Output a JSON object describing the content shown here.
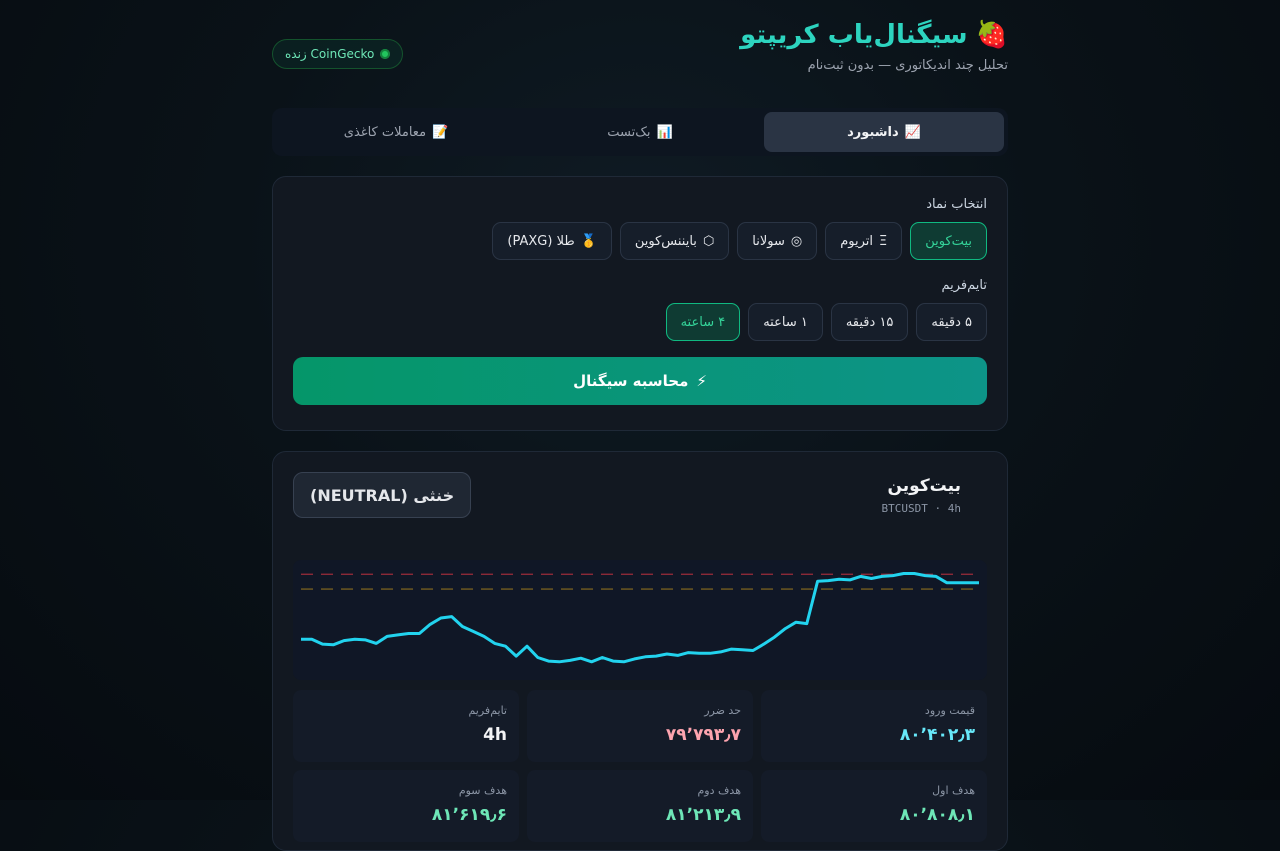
{
  "header": {
    "title": "سیگنال‌یاب کریپتو",
    "subtitle": "تحلیل چند اندیکاتوری — بدون ثبت‌نام",
    "live_label": "CoinGecko زنده"
  },
  "tabs": [
    {
      "icon": "📈",
      "label": "داشبورد",
      "active": true
    },
    {
      "icon": "📊",
      "label": "بک‌تست",
      "active": false
    },
    {
      "icon": "📝",
      "label": "معاملات کاغذی",
      "active": false
    }
  ],
  "symbol_section": {
    "label": "انتخاب نماد",
    "options": [
      {
        "icon": "",
        "label": "بیت‌کوین",
        "active": true
      },
      {
        "icon": "Ξ",
        "label": "اتریوم",
        "active": false
      },
      {
        "icon": "◎",
        "label": "سولانا",
        "active": false
      },
      {
        "icon": "⬡",
        "label": "بایننس‌کوین",
        "active": false
      },
      {
        "icon": "🥇",
        "label": "طلا (PAXG)",
        "active": false
      }
    ]
  },
  "timeframe_section": {
    "label": "تایم‌فریم",
    "options": [
      {
        "label": "۵ دقیقه",
        "active": false
      },
      {
        "label": "۱۵ دقیقه",
        "active": false
      },
      {
        "label": "۱ ساعته",
        "active": false
      },
      {
        "label": "۴ ساعته",
        "active": true
      }
    ]
  },
  "compute_button": {
    "icon": "⚡",
    "label": "محاسبه سیگنال"
  },
  "signal": {
    "coin_name": "بیت‌کوین",
    "pair": "BTCUSDT",
    "timeframe": "4h",
    "verdict": "خنثی (NEUTRAL)"
  },
  "colors": {
    "accent": "#2dd4bf",
    "line": "#22d3ee",
    "stop_line": "#9b2c3a",
    "entry_line": "#8a6d1f"
  },
  "price_series": [
    79580,
    79580,
    79510,
    79500,
    79560,
    79580,
    79570,
    79520,
    79620,
    79640,
    79660,
    79660,
    79790,
    79880,
    79900,
    79760,
    79690,
    79620,
    79520,
    79480,
    79340,
    79480,
    79320,
    79270,
    79260,
    79280,
    79310,
    79260,
    79320,
    79270,
    79260,
    79300,
    79330,
    79340,
    79370,
    79350,
    79390,
    79380,
    79380,
    79400,
    79440,
    79430,
    79420,
    79510,
    79610,
    79730,
    79820,
    79800,
    80400,
    80410,
    80430,
    80420,
    80470,
    80440,
    80470,
    80480,
    80510,
    80510,
    80480,
    80470,
    80380,
    80380,
    80380,
    80380
  ],
  "levels": {
    "stop": 80500,
    "entry": 80290
  },
  "stats": [
    {
      "label": "قیمت ورود",
      "value": "۸۰٬۴۰۲٫۳",
      "tone": "cyan"
    },
    {
      "label": "حد ضرر",
      "value": "۷۹٬۷۹۳٫۷",
      "tone": "red"
    },
    {
      "label": "تایم‌فریم",
      "value": "4h",
      "tone": "white"
    },
    {
      "label": "هدف اول",
      "value": "۸۰٬۸۰۸٫۱",
      "tone": "green"
    },
    {
      "label": "هدف دوم",
      "value": "۸۱٬۲۱۳٫۹",
      "tone": "green"
    },
    {
      "label": "هدف سوم",
      "value": "۸۱٬۶۱۹٫۶",
      "tone": "green"
    }
  ]
}
